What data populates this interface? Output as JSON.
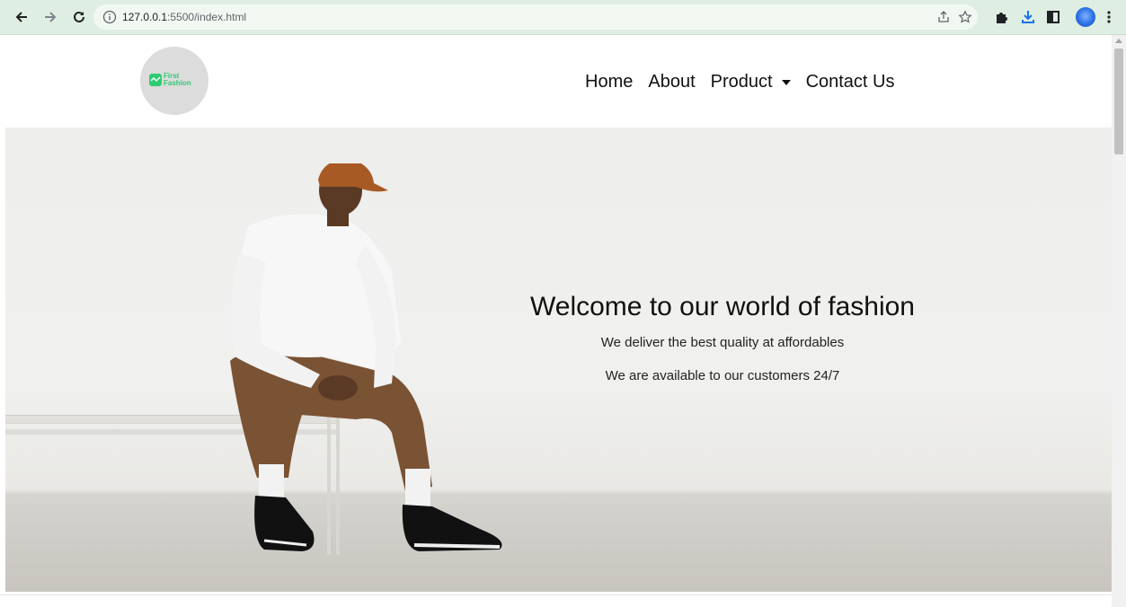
{
  "browser": {
    "url_host": "127.0.0.1",
    "url_rest": ":5500/index.html"
  },
  "site": {
    "logo": {
      "line1": "First",
      "line2": "Fashion"
    },
    "nav": {
      "home": "Home",
      "about": "About",
      "product": "Product",
      "contact": "Contact Us"
    },
    "hero": {
      "title": "Welcome to our world of fashion",
      "line1": "We deliver the best quality at affordables",
      "line2": "We are available to our customers 24/7"
    }
  },
  "colors": {
    "toolbar": "#dfeee2",
    "logo_green": "#2ecc71",
    "cap": "#a85a25",
    "shirt": "#f7f7f7",
    "pants": "#7a5234",
    "skin": "#5a3a24"
  },
  "icons": [
    "back-arrow-icon",
    "forward-arrow-icon",
    "reload-icon",
    "info-icon",
    "share-icon",
    "star-icon",
    "extensions-icon",
    "download-icon",
    "side-panel-icon",
    "profile-avatar",
    "more-vert-icon",
    "chevron-down-icon"
  ]
}
